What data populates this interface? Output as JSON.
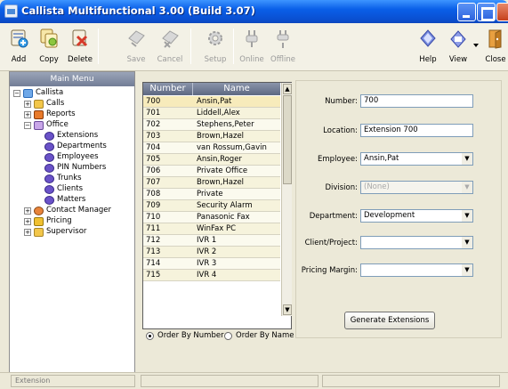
{
  "window": {
    "title": "Callista Multifunctional 3.00 (Build 3.07)"
  },
  "toolbar": {
    "add": "Add",
    "copy": "Copy",
    "delete": "Delete",
    "save": "Save",
    "cancel": "Cancel",
    "setup": "Setup",
    "online": "Online",
    "offline": "Offline",
    "help": "Help",
    "view": "View",
    "close": "Close"
  },
  "main_menu": {
    "header": "Main Menu",
    "items": [
      {
        "label": "Callista"
      },
      {
        "label": "Calls"
      },
      {
        "label": "Reports"
      },
      {
        "label": "Office"
      },
      {
        "label": "Extensions"
      },
      {
        "label": "Departments"
      },
      {
        "label": "Employees"
      },
      {
        "label": "PIN Numbers"
      },
      {
        "label": "Trunks"
      },
      {
        "label": "Clients"
      },
      {
        "label": "Matters"
      },
      {
        "label": "Contact Manager"
      },
      {
        "label": "Pricing"
      },
      {
        "label": "Supervisor"
      }
    ]
  },
  "table": {
    "headers": {
      "number": "Number",
      "name": "Name"
    },
    "rows": [
      {
        "number": "700",
        "name": "Ansin,Pat"
      },
      {
        "number": "701",
        "name": "Liddell,Alex"
      },
      {
        "number": "702",
        "name": "Stephens,Peter"
      },
      {
        "number": "703",
        "name": "Brown,Hazel"
      },
      {
        "number": "704",
        "name": "van Rossum,Gavin"
      },
      {
        "number": "705",
        "name": "Ansin,Roger"
      },
      {
        "number": "706",
        "name": "Private Office"
      },
      {
        "number": "707",
        "name": "Brown,Hazel"
      },
      {
        "number": "708",
        "name": "Private"
      },
      {
        "number": "709",
        "name": "Security Alarm"
      },
      {
        "number": "710",
        "name": "Panasonic Fax"
      },
      {
        "number": "711",
        "name": "WinFax PC"
      },
      {
        "number": "712",
        "name": "IVR 1"
      },
      {
        "number": "713",
        "name": "IVR 2"
      },
      {
        "number": "714",
        "name": "IVR 3"
      },
      {
        "number": "715",
        "name": "IVR 4"
      }
    ]
  },
  "order": {
    "by_number": "Order By Number",
    "by_name": "Order By Name"
  },
  "form": {
    "number_label": "Number:",
    "number_value": "700",
    "location_label": "Location:",
    "location_value": "Extension 700",
    "employee_label": "Employee:",
    "employee_value": "Ansin,Pat",
    "division_label": "Division:",
    "division_value": "(None)",
    "department_label": "Department:",
    "department_value": "Development",
    "client_label": "Client/Project:",
    "client_value": "",
    "pricing_label": "Pricing Margin:",
    "pricing_value": "",
    "generate_button": "Generate Extensions"
  },
  "status": {
    "left": "Extension",
    "middle": "",
    "right": ""
  }
}
